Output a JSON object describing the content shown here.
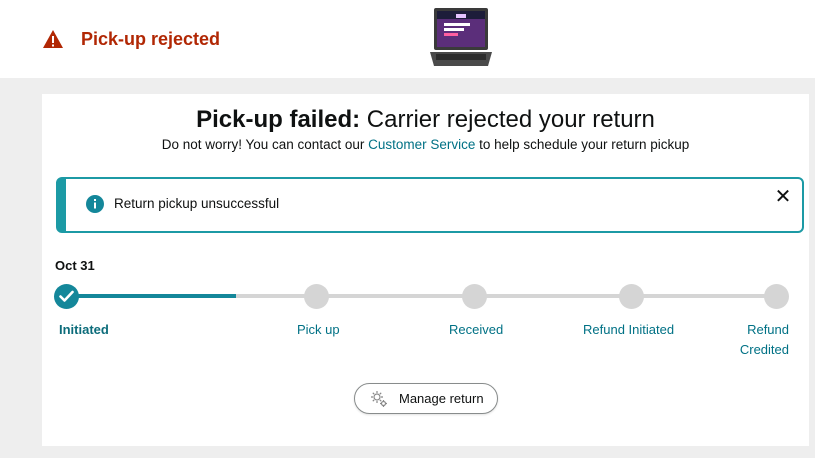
{
  "header": {
    "status_title": "Pick-up rejected",
    "warning_icon": "warning-triangle-icon",
    "product_image": "laptop-thumbnail"
  },
  "main": {
    "headline_bold": "Pick-up failed:",
    "headline_rest": " Carrier rejected your return",
    "sub_before": "Do not worry! You can contact our ",
    "sub_link": "Customer Service",
    "sub_after": " to help schedule your return pickup"
  },
  "alert": {
    "icon": "info-icon",
    "text": "Return pickup unsuccessful",
    "close_label": "✕"
  },
  "progress": {
    "date": "Oct 31",
    "completed_fraction": 0.24,
    "steps": [
      {
        "label": "Initiated",
        "done": true
      },
      {
        "label": "Pick up",
        "done": false
      },
      {
        "label": "Received",
        "done": false
      },
      {
        "label": "Refund Initiated",
        "done": false
      },
      {
        "label": "Refund Credited",
        "done": false
      }
    ]
  },
  "actions": {
    "manage_return": "Manage return",
    "manage_icon": "gear-icon"
  },
  "colors": {
    "accent": "#14879a",
    "alert_title": "#b12704",
    "link": "#007185"
  }
}
